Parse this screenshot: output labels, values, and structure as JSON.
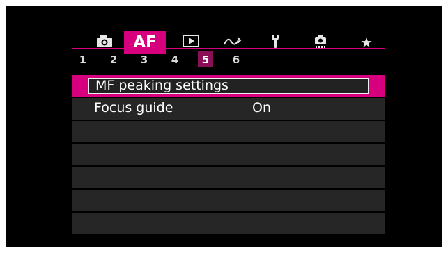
{
  "tabs": [
    {
      "id": "shooting",
      "icon": "camera-icon",
      "glyph": ""
    },
    {
      "id": "af",
      "label": "AF",
      "active": true
    },
    {
      "id": "playback",
      "icon": "play-icon",
      "glyph": ""
    },
    {
      "id": "wireless",
      "icon": "wireless-icon",
      "glyph": ""
    },
    {
      "id": "setup",
      "icon": "wrench-icon",
      "glyph": ""
    },
    {
      "id": "custom",
      "icon": "custom-functions-icon",
      "glyph": ""
    },
    {
      "id": "mymenu",
      "icon": "star-icon",
      "glyph": "★"
    }
  ],
  "pages": [
    "1",
    "2",
    "3",
    "4",
    "5",
    "6"
  ],
  "active_page": "5",
  "menu": {
    "items": [
      {
        "label": "MF peaking settings",
        "value": "",
        "selected": true
      },
      {
        "label": "Focus guide",
        "value": "On",
        "selected": false
      },
      {
        "label": "",
        "value": ""
      },
      {
        "label": "",
        "value": ""
      },
      {
        "label": "",
        "value": ""
      },
      {
        "label": "",
        "value": ""
      },
      {
        "label": "",
        "value": ""
      }
    ]
  },
  "colors": {
    "accent": "#d6007f",
    "page_active": "#8b0e57",
    "row_bg": "#262626",
    "background": "#000000"
  }
}
